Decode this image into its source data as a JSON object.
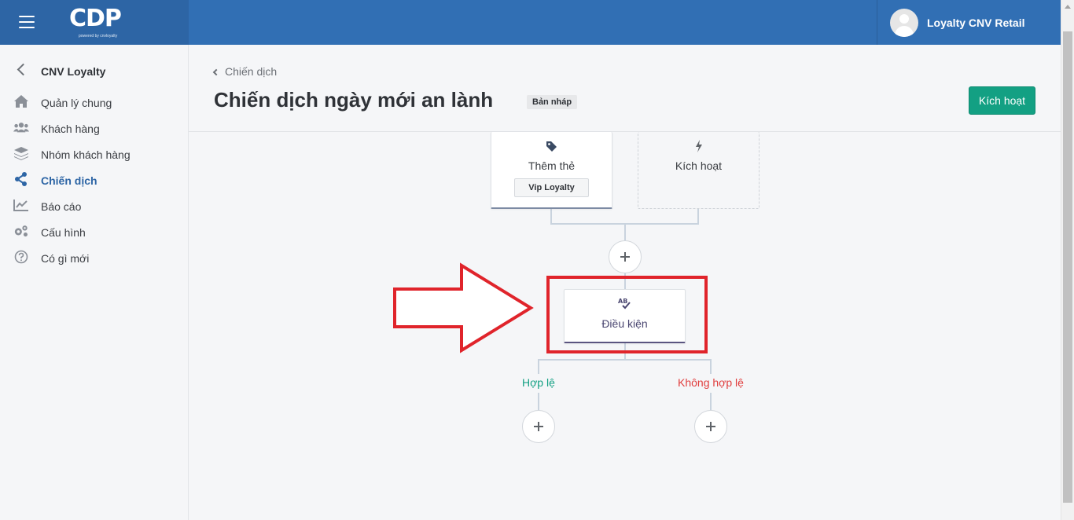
{
  "header": {
    "logo_text": "CDP",
    "logo_subtitle": "powered by cnvloyalty",
    "user_name": "Loyalty CNV Retail"
  },
  "sidebar": {
    "title": "CNV Loyalty",
    "items": [
      {
        "label": "Quản lý chung",
        "icon": "home-icon",
        "active": false
      },
      {
        "label": "Khách hàng",
        "icon": "users-icon",
        "active": false
      },
      {
        "label": "Nhóm khách hàng",
        "icon": "layers-icon",
        "active": false
      },
      {
        "label": "Chiến dịch",
        "icon": "share-icon",
        "active": true
      },
      {
        "label": "Báo cáo",
        "icon": "chart-line-icon",
        "active": false
      },
      {
        "label": "Cấu hình",
        "icon": "gears-icon",
        "active": false
      },
      {
        "label": "Có gì mới",
        "icon": "question-circle-icon",
        "active": false
      }
    ]
  },
  "content": {
    "breadcrumb": "Chiến dịch",
    "title": "Chiến dịch ngày mới an lành",
    "status": "Bản nháp",
    "activate_label": "Kích hoạt"
  },
  "flow": {
    "tag_card": {
      "label": "Thêm thẻ",
      "icon": "tag-icon",
      "chip": "Vip Loyalty"
    },
    "trigger_card": {
      "label": "Kích hoạt",
      "icon": "bolt-icon"
    },
    "condition_card": {
      "label": "Điều kiện",
      "icon": "ab-test-icon"
    },
    "branch_valid": "Hợp lệ",
    "branch_invalid": "Không hợp lệ"
  },
  "colors": {
    "topbar": "#316fb4",
    "accent_green": "#13a083",
    "invalid_red": "#e03d3d",
    "highlight_red": "#e0242b"
  }
}
